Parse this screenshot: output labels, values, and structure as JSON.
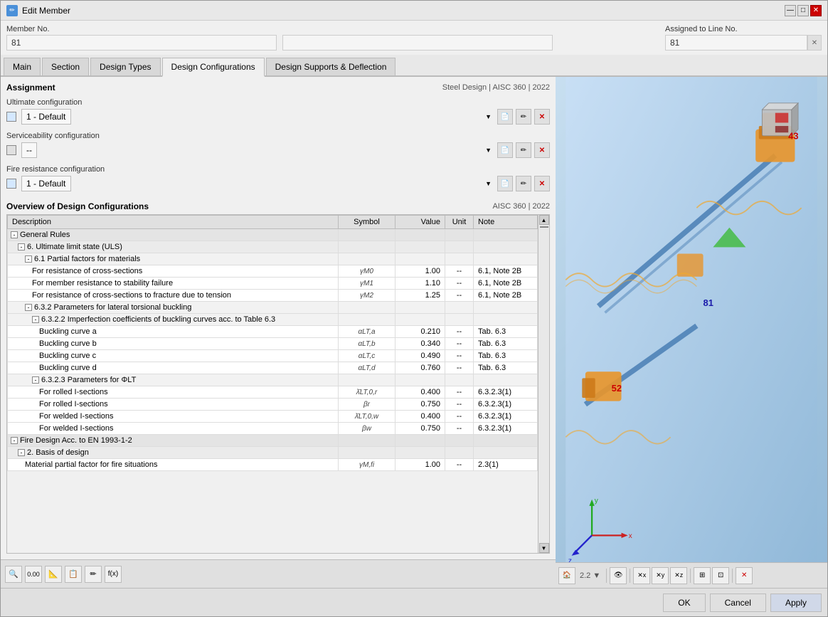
{
  "window": {
    "title": "Edit Member",
    "icon": "✏"
  },
  "header": {
    "member_no_label": "Member No.",
    "member_no_value": "81",
    "assigned_to_line_label": "Assigned to Line No.",
    "assigned_to_line_value": "81"
  },
  "tabs": {
    "items": [
      {
        "id": "main",
        "label": "Main",
        "active": false
      },
      {
        "id": "section",
        "label": "Section",
        "active": false
      },
      {
        "id": "design-types",
        "label": "Design Types",
        "active": false
      },
      {
        "id": "design-configurations",
        "label": "Design Configurations",
        "active": true
      },
      {
        "id": "design-supports-deflection",
        "label": "Design Supports & Deflection",
        "active": false
      }
    ]
  },
  "assignment": {
    "title": "Assignment",
    "standard": "Steel Design | AISC 360 | 2022",
    "ultimate_label": "Ultimate configuration",
    "ultimate_value": "1 - Default",
    "serviceability_label": "Serviceability configuration",
    "serviceability_value": "--",
    "fire_label": "Fire resistance configuration",
    "fire_value": "1 - Default"
  },
  "overview": {
    "title": "Overview of Design Configurations",
    "standard": "AISC 360 | 2022",
    "columns": [
      "Description",
      "Symbol",
      "Value",
      "Unit",
      "Note"
    ],
    "rows": [
      {
        "indent": 0,
        "type": "group",
        "expand": "-",
        "desc": "General Rules",
        "sym": "",
        "val": "",
        "unit": "",
        "note": ""
      },
      {
        "indent": 1,
        "type": "subgroup",
        "expand": "-",
        "desc": "6. Ultimate limit state (ULS)",
        "sym": "",
        "val": "",
        "unit": "",
        "note": ""
      },
      {
        "indent": 2,
        "type": "subgroup2",
        "expand": "-",
        "desc": "6.1 Partial factors for materials",
        "sym": "",
        "val": "",
        "unit": "",
        "note": ""
      },
      {
        "indent": 3,
        "type": "item",
        "expand": "",
        "desc": "For resistance of cross-sections",
        "sym": "γM0",
        "val": "1.00",
        "unit": "--",
        "note": "6.1, Note 2B"
      },
      {
        "indent": 3,
        "type": "item",
        "expand": "",
        "desc": "For member resistance to stability failure",
        "sym": "γM1",
        "val": "1.10",
        "unit": "--",
        "note": "6.1, Note 2B"
      },
      {
        "indent": 3,
        "type": "item",
        "expand": "",
        "desc": "For resistance of cross-sections to fracture due to tension",
        "sym": "γM2",
        "val": "1.25",
        "unit": "--",
        "note": "6.1, Note 2B"
      },
      {
        "indent": 2,
        "type": "subgroup2",
        "expand": "-",
        "desc": "6.3.2 Parameters for lateral torsional buckling",
        "sym": "",
        "val": "",
        "unit": "",
        "note": ""
      },
      {
        "indent": 3,
        "type": "subgroup2",
        "expand": "-",
        "desc": "6.3.2.2 Imperfection coefficients of buckling curves acc. to Table 6.3",
        "sym": "",
        "val": "",
        "unit": "",
        "note": ""
      },
      {
        "indent": 4,
        "type": "item",
        "expand": "",
        "desc": "Buckling curve a",
        "sym": "αLT,a",
        "val": "0.210",
        "unit": "--",
        "note": "Tab. 6.3"
      },
      {
        "indent": 4,
        "type": "item",
        "expand": "",
        "desc": "Buckling curve b",
        "sym": "αLT,b",
        "val": "0.340",
        "unit": "--",
        "note": "Tab. 6.3"
      },
      {
        "indent": 4,
        "type": "item",
        "expand": "",
        "desc": "Buckling curve c",
        "sym": "αLT,c",
        "val": "0.490",
        "unit": "--",
        "note": "Tab. 6.3"
      },
      {
        "indent": 4,
        "type": "item",
        "expand": "",
        "desc": "Buckling curve d",
        "sym": "αLT,d",
        "val": "0.760",
        "unit": "--",
        "note": "Tab. 6.3"
      },
      {
        "indent": 3,
        "type": "subgroup2",
        "expand": "-",
        "desc": "6.3.2.3 Parameters for ΦLT",
        "sym": "",
        "val": "",
        "unit": "",
        "note": ""
      },
      {
        "indent": 4,
        "type": "item",
        "expand": "",
        "desc": "For rolled I-sections",
        "sym": "λ̄LT,0,r",
        "val": "0.400",
        "unit": "--",
        "note": "6.3.2.3(1)"
      },
      {
        "indent": 4,
        "type": "item",
        "expand": "",
        "desc": "For rolled I-sections",
        "sym": "βr",
        "val": "0.750",
        "unit": "--",
        "note": "6.3.2.3(1)"
      },
      {
        "indent": 4,
        "type": "item",
        "expand": "",
        "desc": "For welded I-sections",
        "sym": "λ̄LT,0,w",
        "val": "0.400",
        "unit": "--",
        "note": "6.3.2.3(1)"
      },
      {
        "indent": 4,
        "type": "item",
        "expand": "",
        "desc": "For welded I-sections",
        "sym": "βw",
        "val": "0.750",
        "unit": "--",
        "note": "6.3.2.3(1)"
      },
      {
        "indent": 0,
        "type": "group",
        "expand": "-",
        "desc": "Fire Design Acc. to EN 1993-1-2",
        "sym": "",
        "val": "",
        "unit": "",
        "note": ""
      },
      {
        "indent": 1,
        "type": "subgroup",
        "expand": "-",
        "desc": "2. Basis of design",
        "sym": "",
        "val": "",
        "unit": "",
        "note": ""
      },
      {
        "indent": 2,
        "type": "item",
        "expand": "",
        "desc": "Material partial factor for fire situations",
        "sym": "γM,fi",
        "val": "1.00",
        "unit": "--",
        "note": "2.3(1)"
      }
    ]
  },
  "bottom_bar": {
    "ok_label": "OK",
    "cancel_label": "Cancel",
    "apply_label": "Apply"
  },
  "toolbar": {
    "buttons": [
      "🔍",
      "0.00",
      "📐",
      "📋",
      "✏",
      "f(x)"
    ]
  },
  "viewport": {
    "member_labels": [
      "43",
      "81",
      "52"
    ],
    "axes": {
      "x": "x",
      "y": "y",
      "z": "z"
    }
  }
}
